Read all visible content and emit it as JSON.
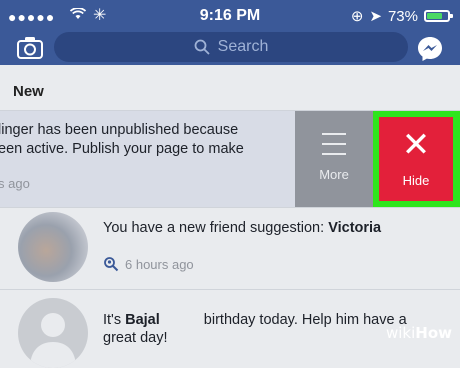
{
  "status_bar": {
    "time": "9:16 PM",
    "battery": "73%",
    "battery_level": 0.73
  },
  "nav": {
    "search_placeholder": "Search"
  },
  "section": {
    "title": "New"
  },
  "notifications": [
    {
      "text_line1": "linger has been unpublished because",
      "text_line2": "een active. Publish your page to make",
      "time": "s ago",
      "actions": {
        "more_label": "More",
        "hide_label": "Hide"
      }
    },
    {
      "text": "You have a new friend suggestion: ",
      "name": "Victoria",
      "time": "6 hours ago"
    },
    {
      "text_prefix": "It's ",
      "name": "Bajal",
      "text_suffix": " birthday today. Help him have a",
      "text_line2": "great day!"
    }
  ],
  "watermark": {
    "part1": "wiki",
    "part2": "How"
  },
  "colors": {
    "facebook_blue": "#3b5998",
    "highlight_green": "#2ee51d",
    "hide_red": "#e3203a"
  }
}
